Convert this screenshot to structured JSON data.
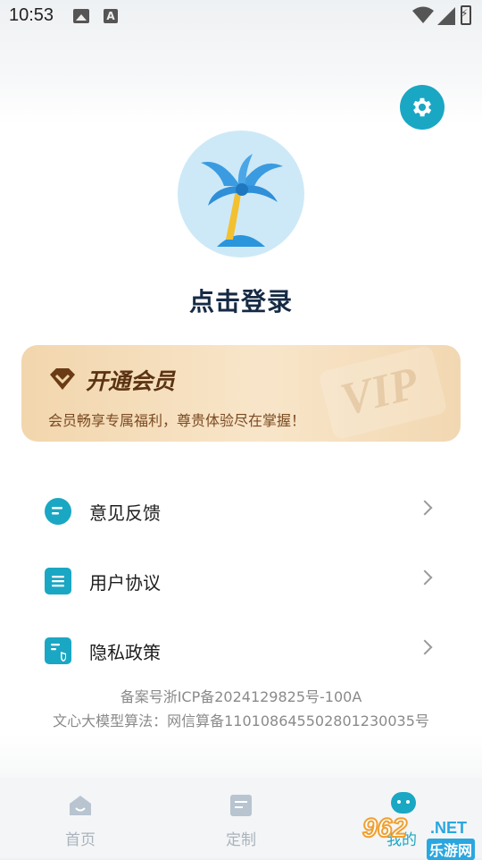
{
  "status_bar": {
    "time": "10:53",
    "a_badge": "A"
  },
  "profile": {
    "login_text": "点击登录",
    "avatar_icon": "palm-tree-icon"
  },
  "vip": {
    "title": "开通会员",
    "subtitle": "会员畅享专属福利，尊贵体验尽在掌握！",
    "watermark": "VIP"
  },
  "menu": {
    "items": [
      {
        "label": "意见反馈",
        "icon": "feedback-icon"
      },
      {
        "label": "用户协议",
        "icon": "agreement-icon"
      },
      {
        "label": "隐私政策",
        "icon": "privacy-icon"
      }
    ]
  },
  "footer": {
    "icp": "备案号浙ICP备2024129825号-100A",
    "algorithm": "文心大模型算法：网信算备110108645502801230035号"
  },
  "bottom_nav": {
    "items": [
      {
        "label": "首页",
        "icon": "home-icon"
      },
      {
        "label": "定制",
        "icon": "customize-icon"
      },
      {
        "label": "我的",
        "icon": "mine-icon"
      }
    ]
  },
  "watermark": {
    "number": "962",
    "net": ".NET",
    "site": "乐游网"
  },
  "colors": {
    "accent": "#1aa7c4",
    "vip_text": "#5b3312",
    "title": "#162a44"
  }
}
